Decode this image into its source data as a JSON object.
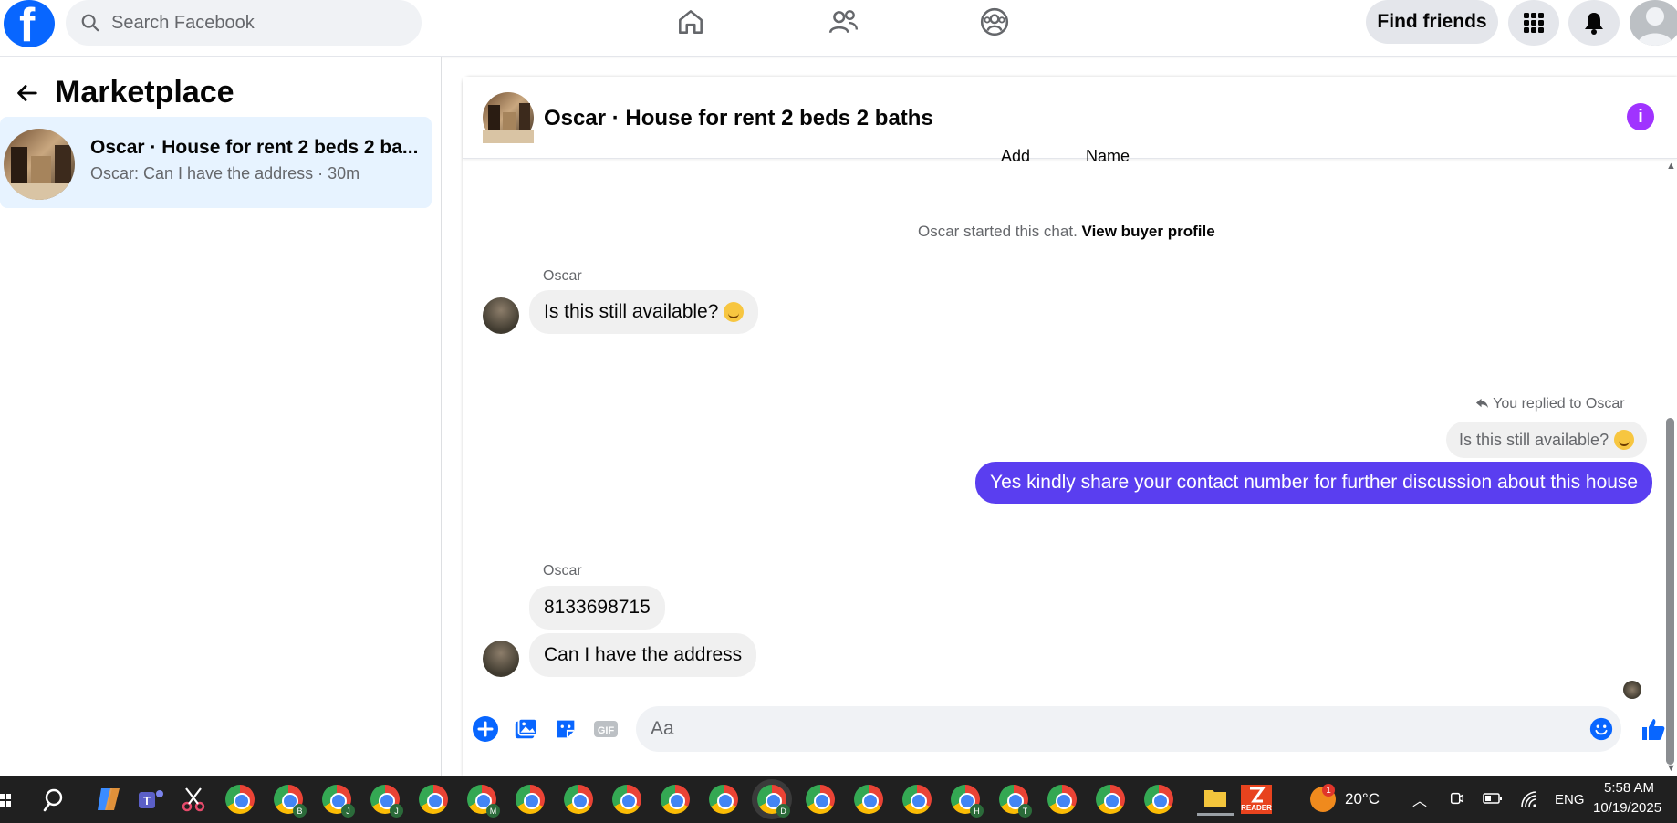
{
  "topbar": {
    "logo_letter": "f",
    "search_placeholder": "Search Facebook",
    "find_friends_label": "Find friends",
    "icons": [
      "home-icon",
      "friends-icon",
      "groups-icon",
      "menu-grid-icon",
      "notifications-icon",
      "account-avatar"
    ]
  },
  "left_panel": {
    "title": "Marketplace",
    "conversations": [
      {
        "title": "Oscar · House for rent 2 beds 2 ba...",
        "subtitle": "Oscar: Can I have the address · 30m"
      }
    ]
  },
  "chat": {
    "title": "Oscar · House for rent 2 beds 2 baths",
    "cut_labels": [
      "Add",
      "Name"
    ],
    "system_message": "Oscar started this chat.",
    "system_link": "View buyer profile",
    "messages": [
      {
        "sender": "Oscar",
        "text": "Is this still available?",
        "emoji": true
      },
      {
        "reply_label": "You replied to Oscar",
        "quoted": "Is this still available?",
        "text": "Yes kindly share your contact number for further discussion about this house"
      },
      {
        "sender": "Oscar",
        "text": "8133698715"
      },
      {
        "text": "Can I have the address"
      }
    ],
    "composer_placeholder": "Aa"
  },
  "colors": {
    "brand": "#0866ff",
    "outgoing_bubble": "#5a3ef0",
    "info": "#a033ff"
  },
  "taskbar": {
    "weather_temp": "20°C",
    "weather_badge": "1",
    "language": "ENG",
    "time": "5:58 AM",
    "date": "10/19/2025",
    "chrome_profile_letters": [
      "",
      "B",
      "J",
      "J",
      "",
      "M",
      "",
      "",
      "",
      "",
      "",
      "D",
      "",
      "",
      "",
      "H",
      "T",
      "",
      "",
      ""
    ]
  }
}
